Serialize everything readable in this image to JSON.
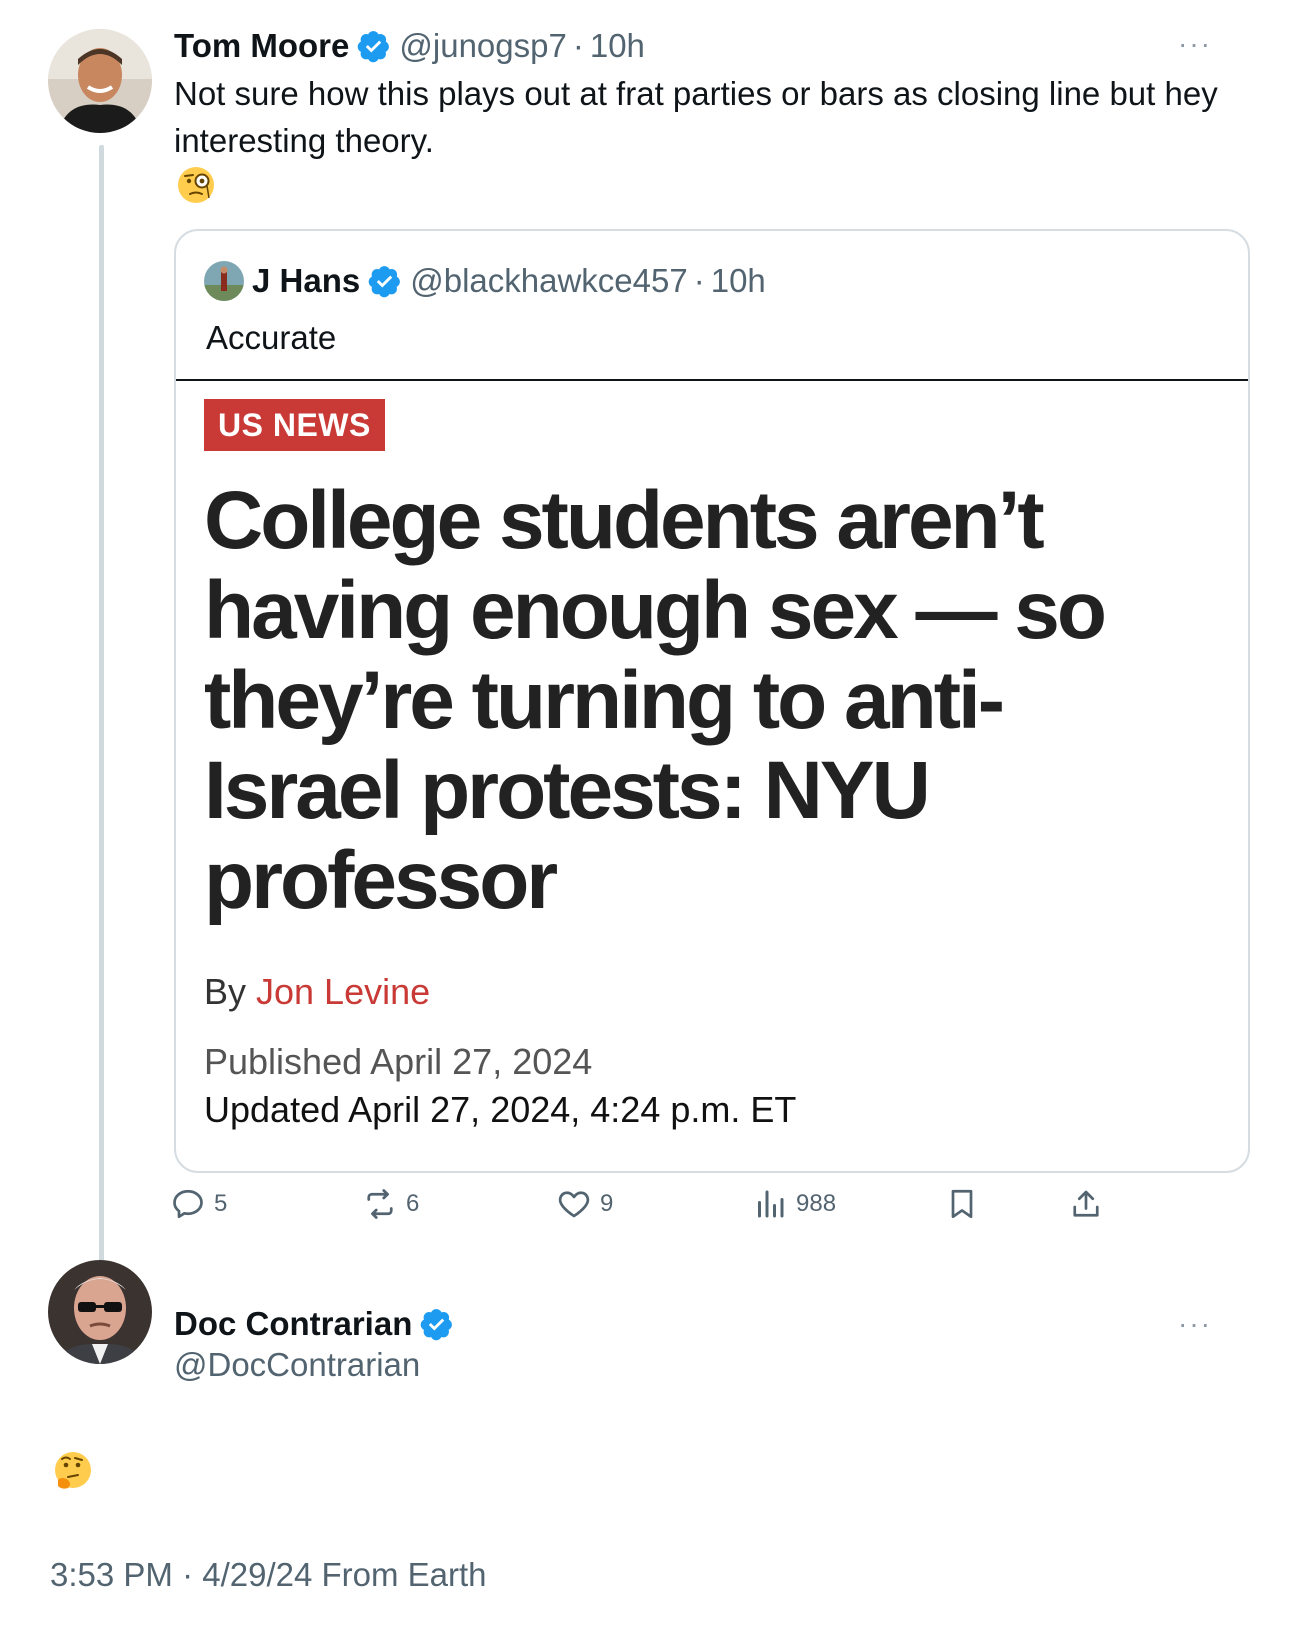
{
  "tweet1": {
    "name": "Tom Moore",
    "handle": "@junogsp7",
    "separator": "·",
    "time": "10h",
    "more": "···",
    "text": "Not sure how this plays out at frat parties or bars as closing line but hey interesting theory.",
    "emoji": "face-with-monocle"
  },
  "quote": {
    "name": "J Hans",
    "handle": "@blackhawkce457",
    "separator": "·",
    "time": "10h",
    "text": "Accurate",
    "article": {
      "tag": "US NEWS",
      "headline": "College students aren’t having enough sex — so they’re turning to anti-Israel protests: NYU professor",
      "by_label": "By ",
      "author": "Jon Levine",
      "published": "Published April 27, 2024",
      "updated": "Updated April 27, 2024, 4:24 p.m. ET"
    }
  },
  "actions": {
    "replies": "5",
    "reposts": "6",
    "likes": "9",
    "views": "988"
  },
  "tweet2": {
    "name": "Doc Contrarian",
    "handle": "@DocContrarian",
    "more": "···",
    "emoji": "thinking-face",
    "timestamp": "3:53 PM · 4/29/24 From Earth"
  },
  "colors": {
    "verified": "#1d9bf0",
    "secondary_text": "#536471",
    "news_red": "#c93a36",
    "thread_line": "#cfd9de"
  }
}
